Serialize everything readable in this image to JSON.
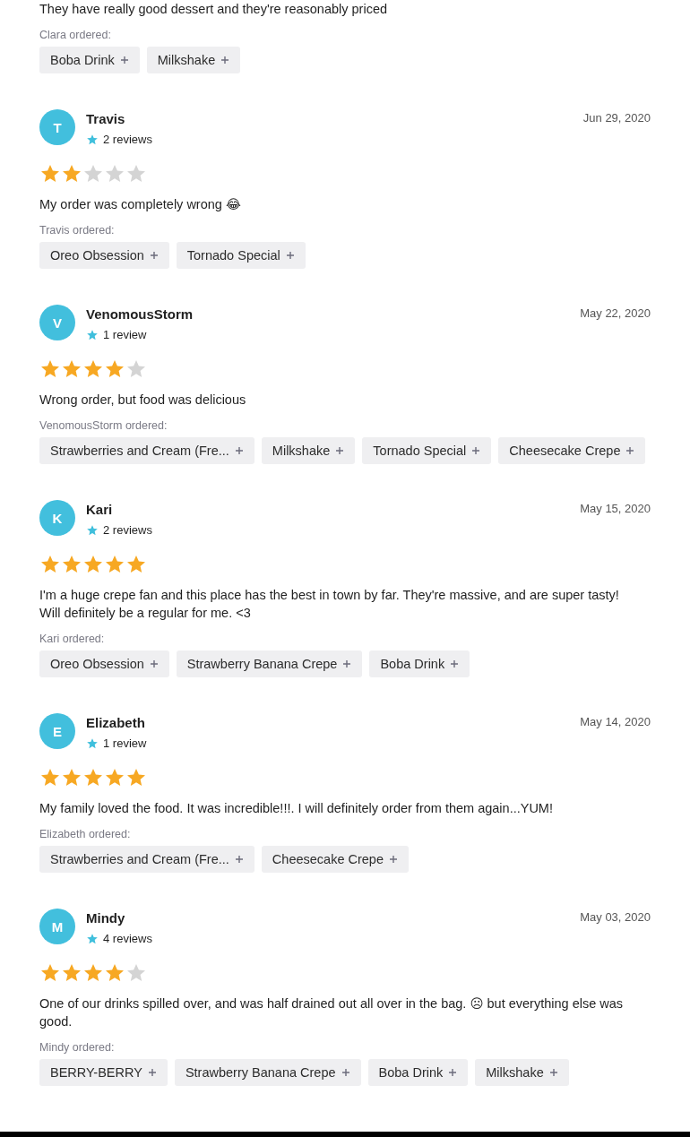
{
  "top_review": {
    "text": "They have really good dessert and they're reasonably priced",
    "ordered_label": "Clara ordered:",
    "items": [
      "Boba Drink",
      "Milkshake"
    ]
  },
  "reviews": [
    {
      "initial": "T",
      "name": "Travis",
      "review_count": "2 reviews",
      "date": "Jun 29, 2020",
      "stars": 2,
      "text": "My order was completely wrong 😂",
      "ordered_label": "Travis ordered:",
      "items": [
        "Oreo Obsession",
        "Tornado Special"
      ]
    },
    {
      "initial": "V",
      "name": "VenomousStorm",
      "review_count": "1 review",
      "date": "May 22, 2020",
      "stars": 4,
      "text": "Wrong order, but food was delicious",
      "ordered_label": "VenomousStorm ordered:",
      "items": [
        "Strawberries and Cream (Fre...",
        "Milkshake",
        "Tornado Special",
        "Cheesecake Crepe"
      ]
    },
    {
      "initial": "K",
      "name": "Kari",
      "review_count": "2 reviews",
      "date": "May 15, 2020",
      "stars": 5,
      "text": "I'm a huge crepe fan and this place has the best in town by far. They're massive, and are super tasty! Will definitely be a regular for me. <3",
      "ordered_label": "Kari ordered:",
      "items": [
        "Oreo Obsession",
        "Strawberry Banana Crepe",
        "Boba Drink"
      ]
    },
    {
      "initial": "E",
      "name": "Elizabeth",
      "review_count": "1 review",
      "date": "May 14, 2020",
      "stars": 5,
      "text": "My family loved the food. It was incredible!!!. I will definitely order from them again...YUM!",
      "ordered_label": "Elizabeth ordered:",
      "items": [
        "Strawberries and Cream (Fre...",
        "Cheesecake Crepe"
      ]
    },
    {
      "initial": "M",
      "name": "Mindy",
      "review_count": "4 reviews",
      "date": "May 03, 2020",
      "stars": 4,
      "text": "One of our drinks spilled over, and was half drained out all over in the bag. ☹ but everything else was good.",
      "ordered_label": "Mindy ordered:",
      "items": [
        "BERRY-BERRY",
        "Strawberry Banana Crepe",
        "Boba Drink",
        "Milkshake"
      ]
    }
  ]
}
